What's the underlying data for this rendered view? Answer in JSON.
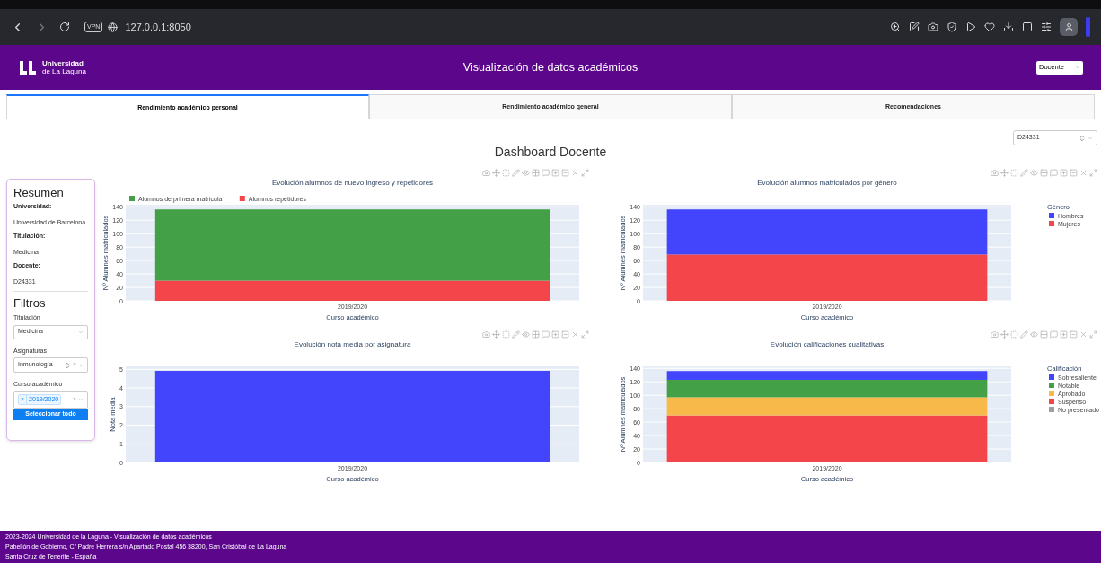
{
  "browser": {
    "vpn_badge": "VPN",
    "url": "127.0.0.1:8050"
  },
  "header": {
    "logo_line1": "Universidad",
    "logo_line2": "de La Laguna",
    "title": "Visualización de datos académicos",
    "role_select": {
      "value": "Docente"
    }
  },
  "tabs": [
    {
      "label": "Rendimiento académico personal",
      "selected": true
    },
    {
      "label": "Rendimiento académico general",
      "selected": false
    },
    {
      "label": "Recomendaciones",
      "selected": false
    }
  ],
  "dashboard": {
    "title": "Dashboard Docente",
    "teacher_select": {
      "value": "D24331"
    }
  },
  "sidebar": {
    "summary_title": "Resumen",
    "summary": [
      {
        "label": "Universidad:",
        "value": "Universidad de Barcelona"
      },
      {
        "label": "Titulación:",
        "value": "Medicina"
      },
      {
        "label": "Docente:",
        "value": "D24331"
      }
    ],
    "filters_title": "Filtros",
    "filters": [
      {
        "kind": "select",
        "label": "Titulación",
        "value": "Medicina"
      },
      {
        "kind": "search-select",
        "label": "Asignaturas",
        "value": "Inmunología",
        "clear": "×"
      },
      {
        "kind": "multi-select",
        "label": "Curso académico",
        "chips": [
          "2019/2020"
        ],
        "chip_remove": "×",
        "clear": "×"
      }
    ],
    "button": "Seleccionar todo"
  },
  "charts": [
    {
      "chart_data": {
        "type": "bar",
        "stacked": true,
        "grid": true,
        "legend": true,
        "title": "Evolución alumnos de nuevo ingreso y repetidores",
        "xlabel": "Curso académico",
        "ylabel": "Nº Alumnes matriculados",
        "categories": [
          "2019/2020"
        ],
        "ylim": [
          0,
          143
        ],
        "yticks": [
          0,
          20,
          40,
          60,
          80,
          100,
          120,
          140
        ],
        "series": [
          {
            "name": "Alumnos de primera matrícula",
            "color": "#43a047",
            "values": [
              106
            ]
          },
          {
            "name": "Alumnos repetidores",
            "color": "#f4454a",
            "values": [
              30
            ]
          }
        ]
      }
    },
    {
      "chart_data": {
        "type": "bar",
        "stacked": true,
        "grid": true,
        "legend": {
          "title": "Género"
        },
        "title": "Evolución alumnos matriculados por género",
        "xlabel": "Curso académico",
        "ylabel": "Nº Alumnes matriculados",
        "categories": [
          "2019/2020"
        ],
        "ylim": [
          0,
          143
        ],
        "yticks": [
          0,
          20,
          40,
          60,
          80,
          100,
          120,
          140
        ],
        "series": [
          {
            "name": "Hombres",
            "color": "#4245fc",
            "values": [
              67
            ]
          },
          {
            "name": "Mujeres",
            "color": "#f4454a",
            "values": [
              69
            ]
          }
        ]
      }
    },
    {
      "chart_data": {
        "type": "bar",
        "stacked": true,
        "grid": true,
        "title": "Evolución nota media por asignatura",
        "xlabel": "Curso académico",
        "ylabel": "Nota media",
        "categories": [
          "2019/2020"
        ],
        "ylim": [
          0,
          5.16
        ],
        "yticks": [
          0,
          1,
          2,
          3,
          4,
          5
        ],
        "series": [
          {
            "color": "#4245fc",
            "values": [
              4.92
            ]
          }
        ]
      }
    },
    {
      "chart_data": {
        "type": "bar",
        "stacked": true,
        "grid": true,
        "legend": {
          "title": "Calificación"
        },
        "title": "Evolución calificaciones cualitativas",
        "xlabel": "Curso académico",
        "ylabel": "Nº Alumnes matriculados",
        "categories": [
          "2019/2020"
        ],
        "ylim": [
          0,
          143
        ],
        "yticks": [
          0,
          20,
          40,
          60,
          80,
          100,
          120,
          140
        ],
        "series": [
          {
            "name": "Sobresaliente",
            "color": "#4245fc",
            "values": [
              13
            ]
          },
          {
            "name": "Notable",
            "color": "#43a047",
            "values": [
              26
            ]
          },
          {
            "name": "Aprobado",
            "color": "#f6b94a",
            "values": [
              27
            ]
          },
          {
            "name": "Suspenso",
            "color": "#f4454a",
            "values": [
              70
            ]
          },
          {
            "name": "No presentado",
            "color": "#9e9e9e",
            "values": [
              0
            ]
          }
        ]
      }
    }
  ],
  "footer": [
    "2023-2024 Universidad de la Laguna - Visualización de datos académicos",
    "Pabellón de Gobierno, C/ Padre Herrera s/n Apartado Postal 456 38200, San Cristóbal de La Laguna",
    "Santa Cruz de Tenerife - España"
  ]
}
